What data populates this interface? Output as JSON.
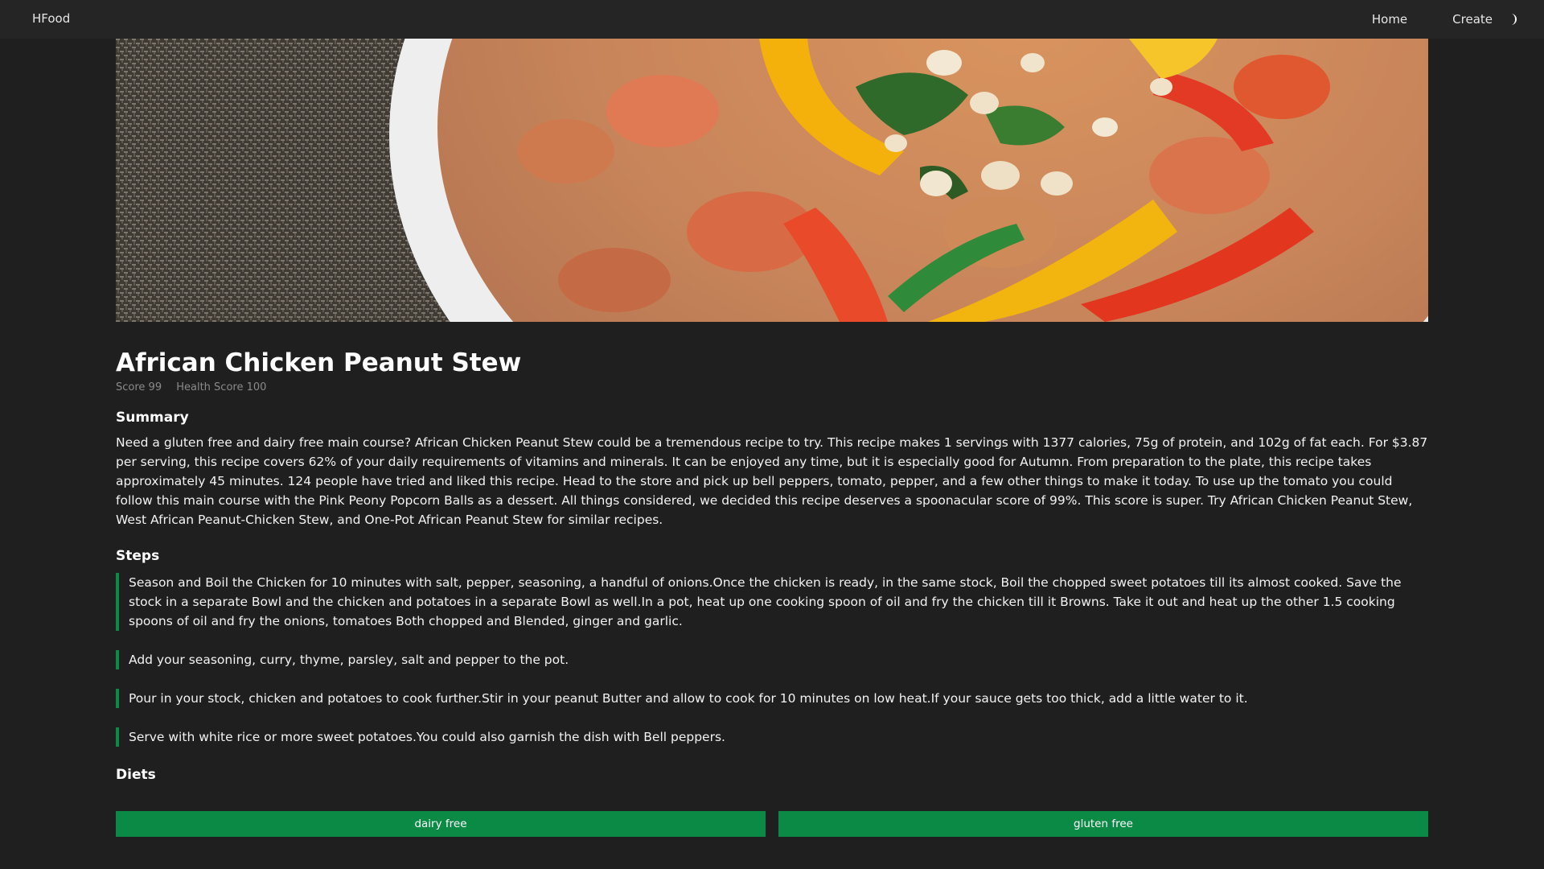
{
  "nav": {
    "brand": "HFood",
    "links": [
      "Home",
      "Create"
    ],
    "theme_icon": "moon-icon"
  },
  "hero": {
    "image": "stew-photo",
    "colors": {
      "placemat": "#4a443d",
      "bowl": "#f1f1f1",
      "stew": "#c98a5a",
      "pepper_yellow": "#f3b20e",
      "pepper_red": "#e23621",
      "herb_green": "#2f6a2a",
      "peanut": "#efe2c9"
    }
  },
  "recipe": {
    "title": "African Chicken Peanut Stew",
    "score": "Score 99",
    "health_score": "Health Score 100",
    "summary_heading": "Summary",
    "summary": "Need a gluten free and dairy free main course? African Chicken Peanut Stew could be a tremendous recipe to try. This recipe makes 1 servings with 1377 calories, 75g of protein, and 102g of fat each. For $3.87 per serving, this recipe covers 62% of your daily requirements of vitamins and minerals. It can be enjoyed any time, but it is especially good for Autumn. From preparation to the plate, this recipe takes approximately 45 minutes. 124 people have tried and liked this recipe. Head to the store and pick up bell peppers, tomato, pepper, and a few other things to make it today. To use up the tomato you could follow this main course with the Pink Peony Popcorn Balls as a dessert. All things considered, we decided this recipe deserves a spoonacular score of 99%. This score is super. Try African Chicken Peanut Stew, West African Peanut-Chicken Stew, and One-Pot African Peanut Stew for similar recipes.",
    "steps_heading": "Steps",
    "steps": [
      "Season and Boil the Chicken for 10 minutes with salt, pepper, seasoning, a handful of onions.Once the chicken is ready, in the same stock, Boil the chopped sweet potatoes till its almost cooked. Save the stock in a separate Bowl and the chicken and potatoes in a separate Bowl as well.In a pot, heat up one cooking spoon of oil and fry the chicken till it Browns. Take it out and heat up the other 1.5 cooking spoons of oil and fry the onions, tomatoes Both chopped and Blended, ginger and garlic.",
      "Add your seasoning, curry, thyme, parsley, salt and pepper to the pot.",
      "Pour in your stock, chicken and potatoes to cook further.Stir in your peanut Butter and allow to cook for 10 minutes on low heat.If your sauce gets too thick, add a little water to it.",
      "Serve with white rice or more sweet potatoes.You could also garnish the dish with Bell peppers."
    ],
    "diets_heading": "Diets",
    "diets": [
      "dairy free",
      "gluten free"
    ]
  },
  "colors": {
    "background": "#1f1f1f",
    "navbar": "#252525",
    "accent_green": "#0b8a46",
    "muted_text": "#8a8a8a"
  }
}
